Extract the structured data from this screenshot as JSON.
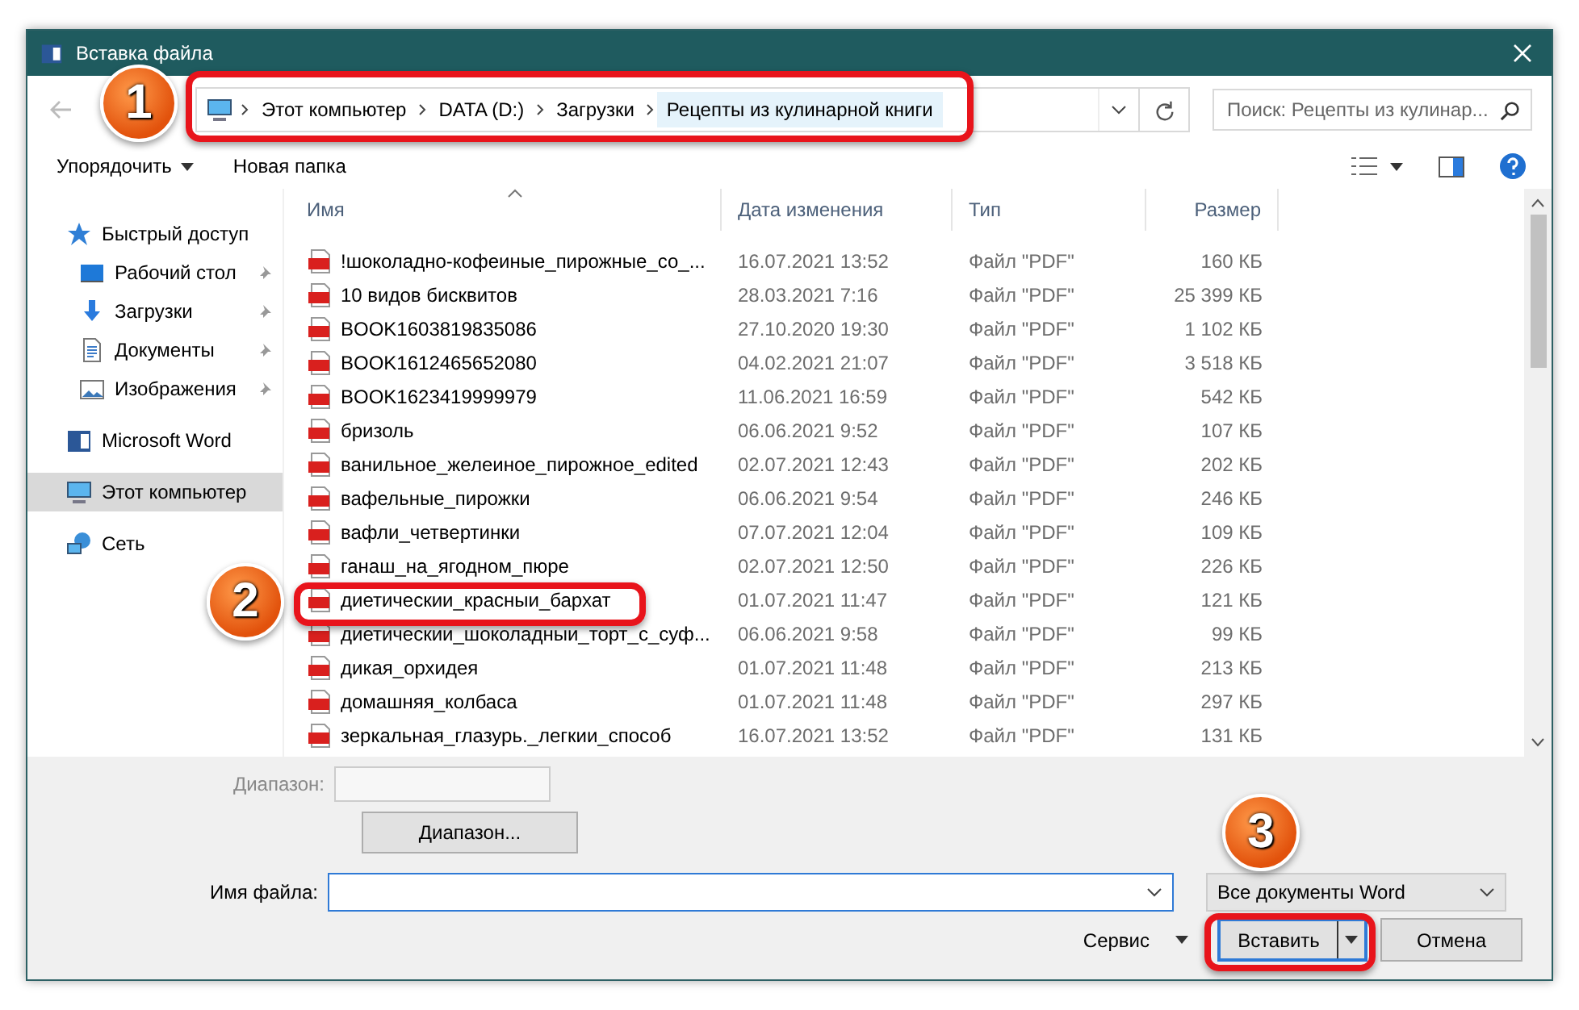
{
  "window": {
    "title": "Вставка файла"
  },
  "address_bar": {
    "segments": [
      {
        "label": "Этот компьютер",
        "highlighted": false
      },
      {
        "label": "DATA (D:)",
        "highlighted": false
      },
      {
        "label": "Загрузки",
        "highlighted": false
      },
      {
        "label": "Рецепты из кулинарной книги",
        "highlighted": true
      }
    ]
  },
  "search": {
    "placeholder": "Поиск: Рецепты из кулинар..."
  },
  "toolbar": {
    "items": [
      {
        "label": "Упорядочить",
        "kind": "menu"
      },
      {
        "label": "Новая папка",
        "kind": "button"
      }
    ]
  },
  "sidebar": {
    "items": [
      {
        "label": "Быстрый доступ",
        "kind": "star",
        "selected": false,
        "children": [
          {
            "label": "Рабочий стол",
            "kind": "desktop",
            "pinned": true,
            "selected": false
          },
          {
            "label": "Загрузки",
            "kind": "download",
            "pinned": true,
            "selected": false
          },
          {
            "label": "Документы",
            "kind": "document",
            "pinned": true,
            "selected": false
          },
          {
            "label": "Изображения",
            "kind": "image",
            "pinned": true,
            "selected": false
          }
        ]
      },
      {
        "label": "Microsoft Word",
        "kind": "word",
        "selected": false
      },
      {
        "label": "Этот компьютер",
        "kind": "computer",
        "selected": true
      },
      {
        "label": "Сеть",
        "kind": "network",
        "selected": false
      }
    ]
  },
  "table": {
    "columns": [
      {
        "label": "Имя",
        "sorted": true
      },
      {
        "label": "Дата изменения",
        "sorted": false
      },
      {
        "label": "Тип",
        "sorted": false
      },
      {
        "label": "Размер",
        "sorted": false
      }
    ],
    "rows": [
      {
        "name": "!шоколадно-кофеиные_пирожные_со_...",
        "date": "16.07.2021 13:52",
        "type": "Файл \"PDF\"",
        "size": "160 КБ"
      },
      {
        "name": "10 видов бисквитов",
        "date": "28.03.2021 7:16",
        "type": "Файл \"PDF\"",
        "size": "25 399 КБ"
      },
      {
        "name": "BOOK1603819835086",
        "date": "27.10.2020 19:30",
        "type": "Файл \"PDF\"",
        "size": "1 102 КБ"
      },
      {
        "name": "BOOK1612465652080",
        "date": "04.02.2021 21:07",
        "type": "Файл \"PDF\"",
        "size": "3 518 КБ"
      },
      {
        "name": "BOOK1623419999979",
        "date": "11.06.2021 16:59",
        "type": "Файл \"PDF\"",
        "size": "542 КБ"
      },
      {
        "name": "бризоль",
        "date": "06.06.2021 9:52",
        "type": "Файл \"PDF\"",
        "size": "107 КБ"
      },
      {
        "name": "ванильное_желеиное_пирожное_edited",
        "date": "02.07.2021 12:43",
        "type": "Файл \"PDF\"",
        "size": "202 КБ"
      },
      {
        "name": "вафельные_пирожки",
        "date": "06.06.2021 9:54",
        "type": "Файл \"PDF\"",
        "size": "246 КБ"
      },
      {
        "name": "вафли_четвертинки",
        "date": "07.07.2021 12:04",
        "type": "Файл \"PDF\"",
        "size": "109 КБ"
      },
      {
        "name": "ганаш_на_ягодном_пюре",
        "date": "02.07.2021 12:50",
        "type": "Файл \"PDF\"",
        "size": "226 КБ"
      },
      {
        "name": "диетическии_красныи_бархат",
        "date": "01.07.2021 11:47",
        "type": "Файл \"PDF\"",
        "size": "121 КБ"
      },
      {
        "name": "диетическии_шоколадныи_торт_с_суф...",
        "date": "06.06.2021 9:58",
        "type": "Файл \"PDF\"",
        "size": "99 КБ"
      },
      {
        "name": "дикая_орхидея",
        "date": "01.07.2021 11:48",
        "type": "Файл \"PDF\"",
        "size": "213 КБ"
      },
      {
        "name": "домашняя_колбаса",
        "date": "01.07.2021 11:48",
        "type": "Файл \"PDF\"",
        "size": "297 КБ"
      },
      {
        "name": "зеркальная_глазурь._легкии_способ",
        "date": "16.07.2021 13:52",
        "type": "Файл \"PDF\"",
        "size": "131 КБ"
      }
    ]
  },
  "range": {
    "label": "Диапазон:",
    "disabled": true,
    "button": "Диапазон..."
  },
  "file_name": {
    "label": "Имя файла:"
  },
  "file_type": {
    "value": "Все документы Word"
  },
  "buttons": {
    "tools": "Сервис",
    "insert": "Вставить",
    "cancel": "Отмена"
  },
  "annotations": [
    {
      "label": "1"
    },
    {
      "label": "2"
    },
    {
      "label": "3"
    }
  ]
}
